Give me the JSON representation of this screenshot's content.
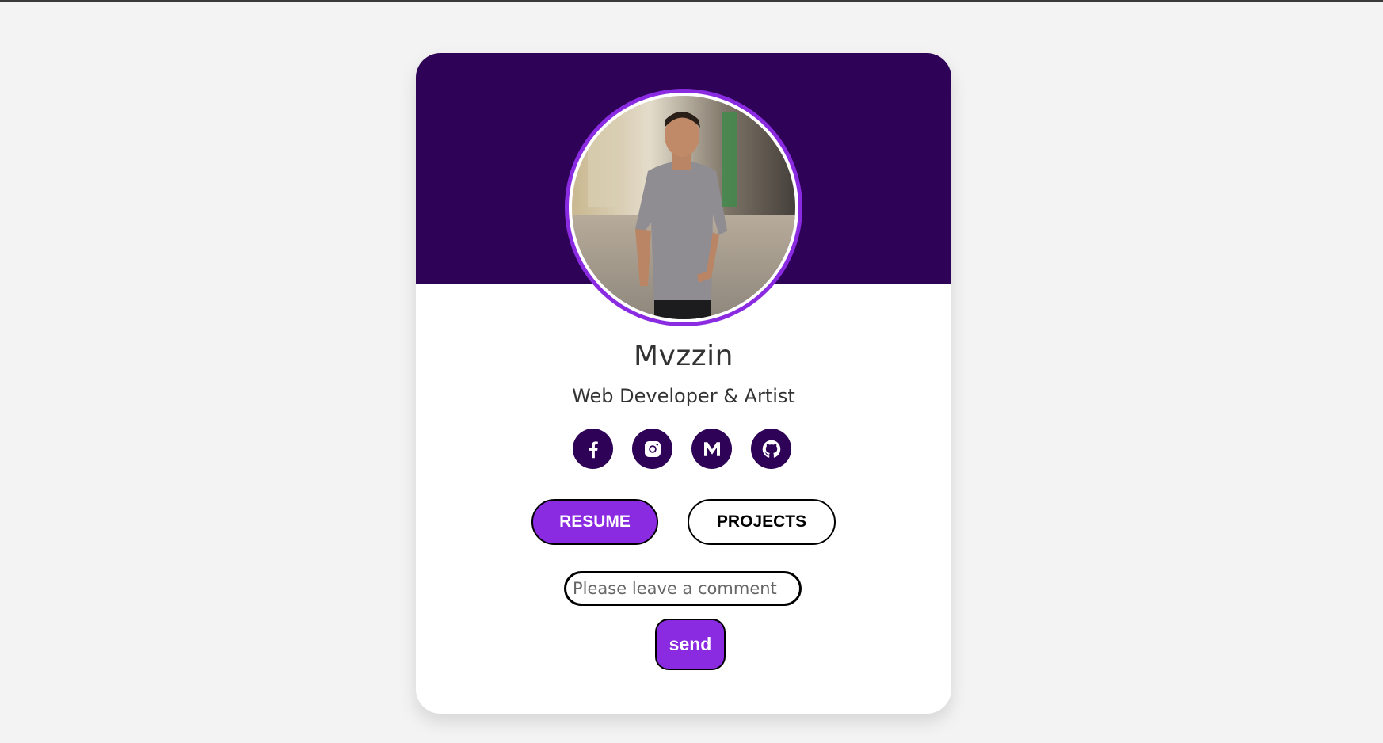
{
  "profile": {
    "name": "Mvzzin",
    "role": "Web Developer & Artist"
  },
  "socials": [
    {
      "icon": "facebook-icon"
    },
    {
      "icon": "instagram-icon"
    },
    {
      "icon": "medium-icon"
    },
    {
      "icon": "github-icon"
    }
  ],
  "actions": {
    "resume_label": "RESUME",
    "projects_label": "PROJECTS"
  },
  "comment": {
    "placeholder": "Please leave a comment",
    "value": "",
    "send_label": "send"
  },
  "colors": {
    "banner": "#2e0257",
    "accent": "#8a2be2",
    "page_bg": "#f3f3f3",
    "text": "#333333"
  }
}
